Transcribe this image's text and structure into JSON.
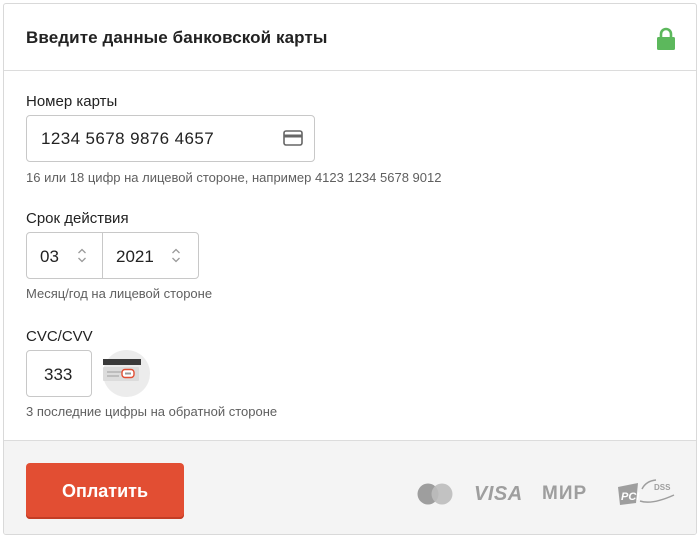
{
  "header": {
    "title": "Введите данные банковской карты",
    "lock_color": "#5cb85c"
  },
  "card_number": {
    "label": "Номер карты",
    "value": "1234 5678 9876 4657",
    "hint": "16 или 18 цифр на лицевой стороне, например 4123 1234 5678 9012",
    "icon": "credit-card-icon"
  },
  "expiry": {
    "label": "Срок действия",
    "month": "03",
    "year": "2021",
    "hint": "Месяц/год на лицевой стороне"
  },
  "cvc": {
    "label": "CVC/CVV",
    "value": "333",
    "hint": "3 последние цифры на обратной стороне"
  },
  "footer": {
    "pay_label": "Оплатить",
    "pay_color": "#e24e33",
    "logos": {
      "mastercard": "mastercard-logo",
      "visa": "VISA",
      "mir": "МИР",
      "pci": "DSS"
    }
  }
}
